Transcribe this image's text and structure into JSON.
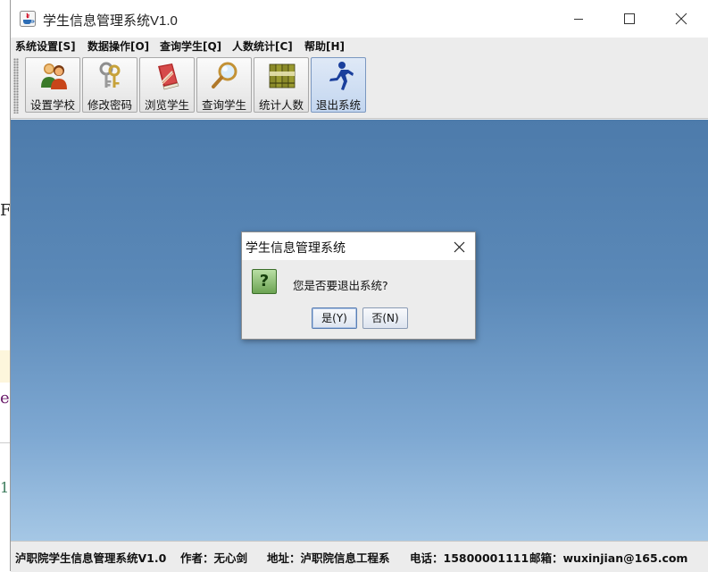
{
  "window": {
    "title": "学生信息管理系统V1.0"
  },
  "menu": [
    {
      "label": "系统设置[S]"
    },
    {
      "label": "数据操作[O]"
    },
    {
      "label": "查询学生[Q]"
    },
    {
      "label": "人数统计[C]"
    },
    {
      "label": "帮助[H]"
    }
  ],
  "toolbar": [
    {
      "label": "设置学校",
      "icon": "users-icon"
    },
    {
      "label": "修改密码",
      "icon": "keys-icon"
    },
    {
      "label": "浏览学生",
      "icon": "book-icon"
    },
    {
      "label": "查询学生",
      "icon": "magnifier-icon"
    },
    {
      "label": "统计人数",
      "icon": "books-icon"
    },
    {
      "label": "退出系统",
      "icon": "running-man-icon"
    }
  ],
  "dialog": {
    "title": "学生信息管理系统",
    "message": "您是否要退出系统?",
    "yes_label": "是(Y)",
    "no_label": "否(N)"
  },
  "status": {
    "app": "泸职院学生信息管理系统V1.0",
    "author": "作者：无心剑",
    "address": "地址：泸职院信息工程系",
    "phone": "电话：15800001111",
    "email": "邮箱：wuxinjian@165.com"
  },
  "background_fragments": [
    "F",
    "e",
    "1"
  ]
}
